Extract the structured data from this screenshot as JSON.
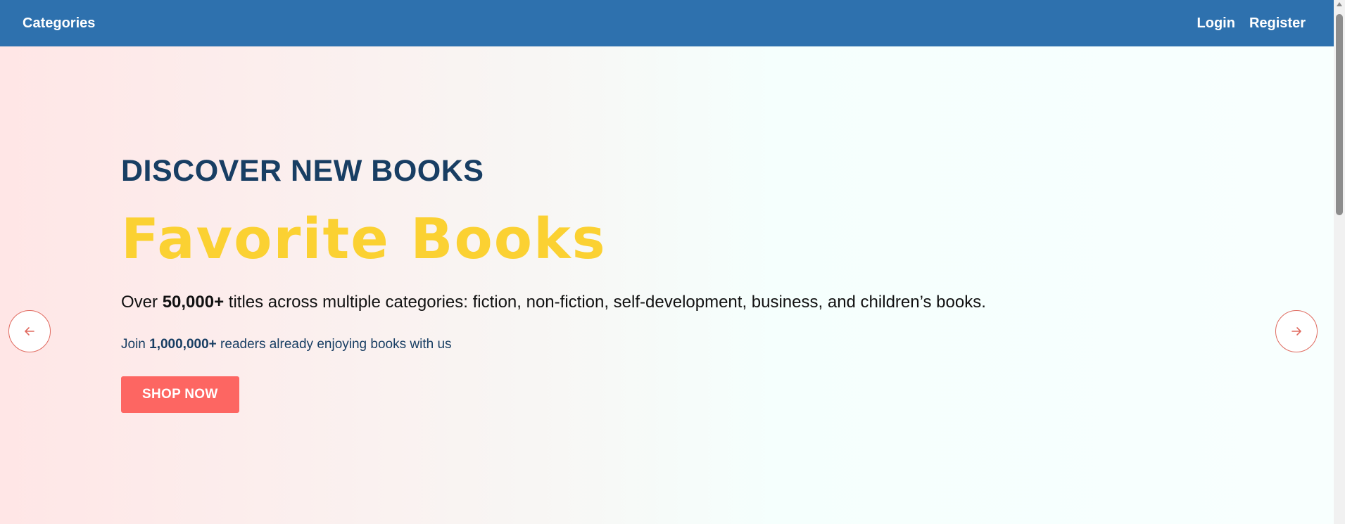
{
  "navbar": {
    "categories_label": "Categories",
    "login_label": "Login",
    "register_label": "Register"
  },
  "hero": {
    "eyebrow": "DISCOVER NEW BOOKS",
    "headline": "Favorite Books",
    "description": {
      "prefix": "Over ",
      "highlight": "50,000+",
      "suffix": " titles across multiple categories: fiction, non-fiction, self-development, business, and children’s books."
    },
    "join": {
      "prefix": "Join ",
      "highlight": "1,000,000+",
      "suffix": " readers already enjoying books with us"
    },
    "cta_label": "SHOP NOW"
  },
  "carousel": {
    "prev_icon": "arrow-left-icon",
    "next_icon": "arrow-right-icon"
  },
  "colors": {
    "navbar": "#2e71ae",
    "eyebrow": "#183e63",
    "headline": "#fbd132",
    "cta": "#fd6662",
    "arrow_border": "#e06a5f"
  }
}
